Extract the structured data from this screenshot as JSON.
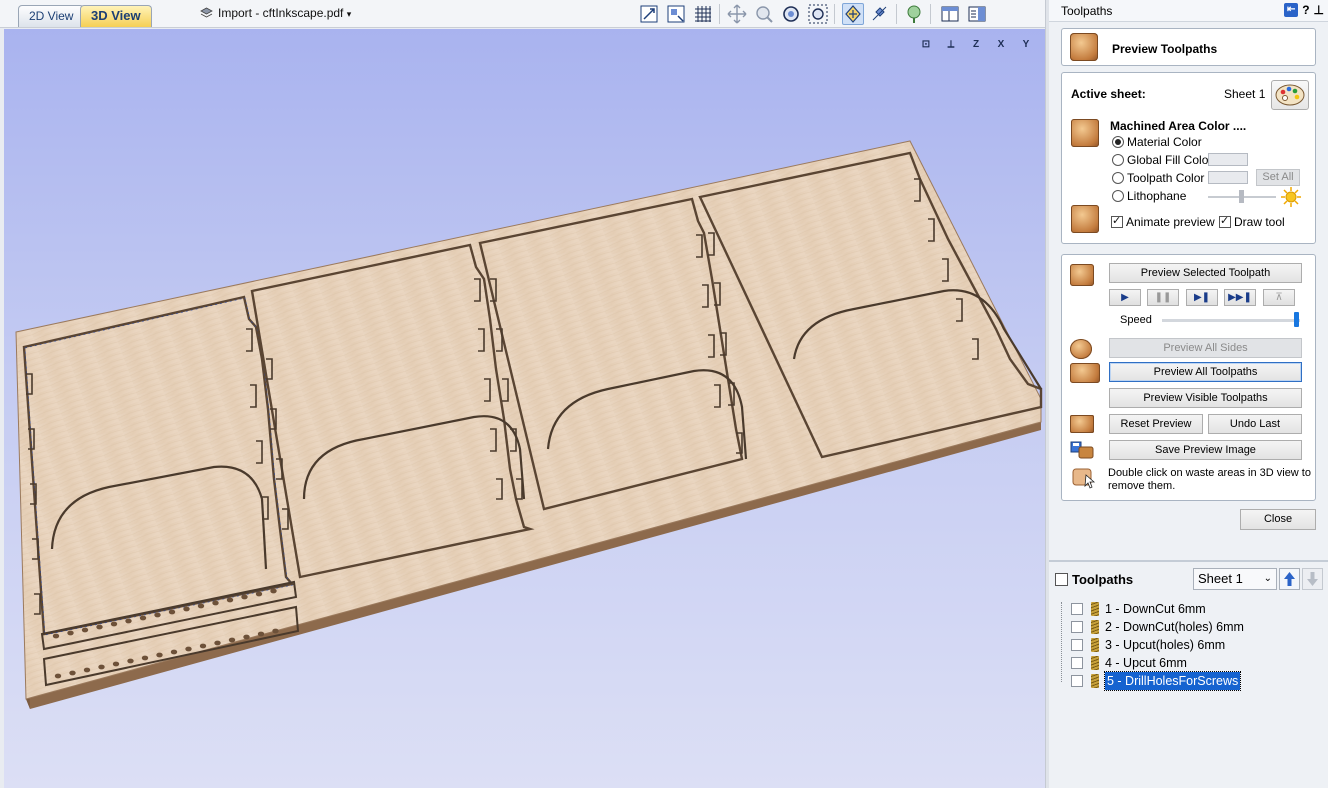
{
  "tabs": {
    "view2d": "2D View",
    "view3d": "3D View"
  },
  "file": {
    "label": "Import - cftInkscape.pdf",
    "dropdown_icon": "chevron-down-icon"
  },
  "toolbar_icons": [
    "zoom-extents-icon",
    "zoom-sheet-icon",
    "grid-icon",
    "pan-icon",
    "zoom-in-icon",
    "zoom-box-icon",
    "zoom-selected-icon",
    "view-mode-icon",
    "view-mode-2-icon",
    "material-icon",
    "layout-icon",
    "layout-2-icon"
  ],
  "view_orient": {
    "fit": "",
    "iso": "",
    "z": "Z",
    "x": "X",
    "y": "Y"
  },
  "panel": {
    "title": "Toolpaths",
    "header_icons": [
      "pin-icon",
      "help-icon",
      "autohide-icon"
    ],
    "preview_title": "Preview Toolpaths",
    "active_sheet_label": "Active sheet:",
    "active_sheet_value": "Sheet 1",
    "machined_area_label": "Machined Area Color ....",
    "options": {
      "material": "Material Color",
      "global_fill": "Global Fill Color",
      "toolpath": "Toolpath Color",
      "lithophane": "Lithophane"
    },
    "set_all": "Set All",
    "animate_preview": "Animate preview",
    "draw_tool": "Draw tool",
    "preview_selected": "Preview Selected Toolpath",
    "speed_label": "Speed",
    "speed_value": 0.98,
    "preview_all_sides": "Preview All Sides",
    "preview_all_toolpaths": "Preview All Toolpaths",
    "preview_visible": "Preview Visible Toolpaths",
    "reset_preview": "Reset Preview",
    "undo_last": "Undo Last",
    "save_preview_image": "Save Preview Image",
    "hint": "Double click on waste areas in 3D view to remove them.",
    "close": "Close"
  },
  "toolpaths": {
    "header": "Toolpaths",
    "sheet": "Sheet 1",
    "items": [
      {
        "name": "1 - DownCut 6mm",
        "selected": false
      },
      {
        "name": "2 - DownCut(holes) 6mm",
        "selected": false
      },
      {
        "name": "3 - Upcut(holes) 6mm",
        "selected": false
      },
      {
        "name": "4 - Upcut 6mm",
        "selected": false
      },
      {
        "name": "5 - DrillHolesForScrews",
        "selected": true
      }
    ]
  },
  "colors": {
    "accent": "#1563d0",
    "wood": "#e6cfb8",
    "wood_edge": "#8d6a4c"
  }
}
